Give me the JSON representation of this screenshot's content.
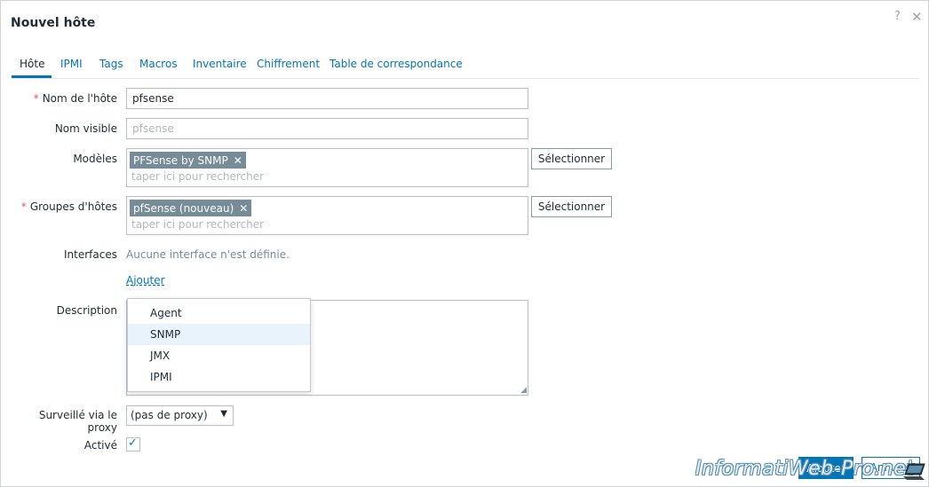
{
  "dialog": {
    "title": "Nouvel hôte",
    "help": "?",
    "close": "✕"
  },
  "tabs": [
    {
      "label": "Hôte",
      "active": true
    },
    {
      "label": "IPMI"
    },
    {
      "label": "Tags"
    },
    {
      "label": "Macros"
    },
    {
      "label": "Inventaire"
    },
    {
      "label": "Chiffrement"
    },
    {
      "label": "Table de correspondance"
    }
  ],
  "form": {
    "required_marker": "*",
    "host_name": {
      "label": "Nom de l'hôte",
      "value": "pfsense"
    },
    "visible_name": {
      "label": "Nom visible",
      "placeholder": "pfsense"
    },
    "templates": {
      "label": "Modèles",
      "chip": "PFSense by SNMP",
      "chip_remove": "✕",
      "search_placeholder": "taper ici pour rechercher",
      "select_button": "Sélectionner"
    },
    "host_groups": {
      "label": "Groupes d'hôtes",
      "chip": "pfSense (nouveau)",
      "chip_remove": "✕",
      "search_placeholder": "taper ici pour rechercher",
      "select_button": "Sélectionner"
    },
    "interfaces": {
      "label": "Interfaces",
      "empty_text": "Aucune interface n'est définie.",
      "add_link": "Ajouter"
    },
    "description": {
      "label": "Description",
      "resize": "◢"
    },
    "proxy": {
      "label": "Surveillé via le proxy",
      "selected": "(pas de proxy)",
      "chevron": "▼"
    },
    "enabled": {
      "label": "Activé",
      "checked": true,
      "check": "✓"
    }
  },
  "interface_dropdown": {
    "items": [
      "Agent",
      "SNMP",
      "JMX",
      "IPMI"
    ],
    "hovered": "SNMP"
  },
  "footer": {
    "add_button": "Ajouter",
    "cancel_button": "Annuler"
  },
  "watermark": {
    "text": "InformatiWeb-Pro.net"
  },
  "colors": {
    "accent": "#0275b8",
    "required": "#e45959",
    "chip": "#768d99"
  }
}
